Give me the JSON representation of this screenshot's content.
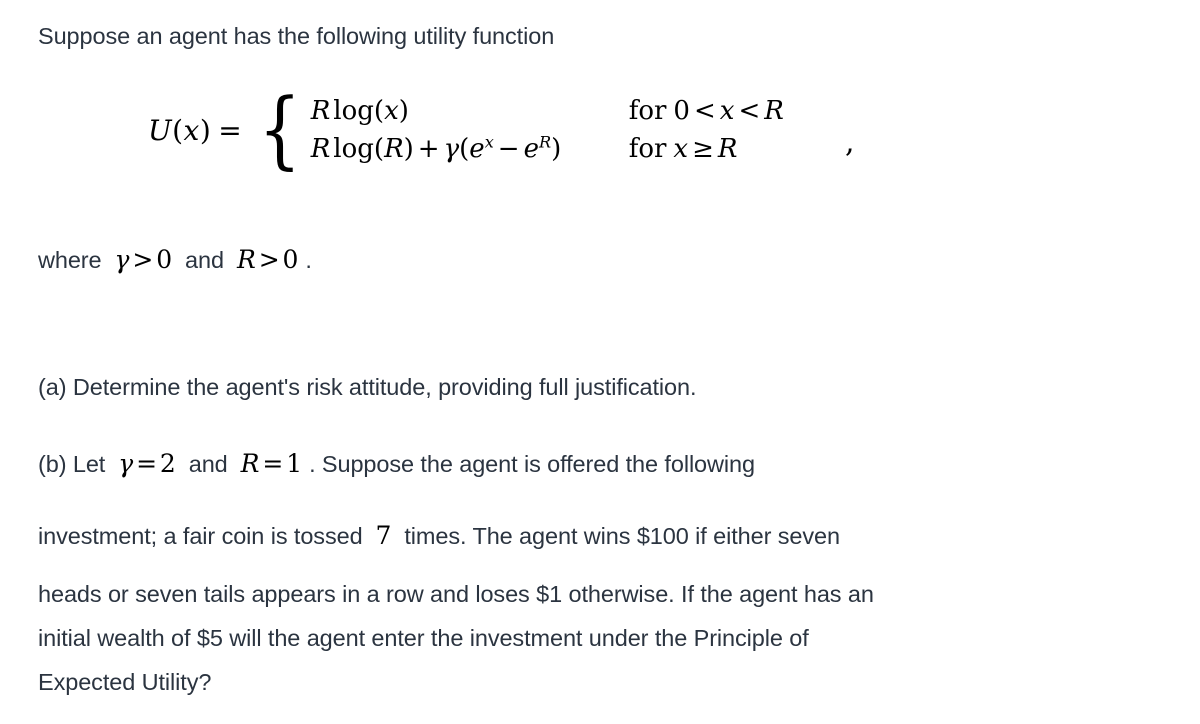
{
  "document": {
    "background_color": "#ffffff",
    "text_color": "#2b3440",
    "math_color": "#000000"
  },
  "intro": {
    "text": "Suppose an agent has the following utility function"
  },
  "equation": {
    "lhs": {
      "function_name": "U",
      "open_paren": "(",
      "argument": "x",
      "close_paren": ")",
      "equals": "="
    },
    "brace": "{",
    "cases": [
      {
        "expression_R": "R",
        "expression_log": "log",
        "expression_open": "(",
        "expression_arg": "x",
        "expression_close": ")",
        "condition_for": "for",
        "condition_lower": "0",
        "condition_lt1": "<",
        "condition_var": "x",
        "condition_lt2": "<",
        "condition_upper": "R"
      },
      {
        "expression_R": "R",
        "expression_log": "log",
        "expression_open": "(",
        "expression_arg": "R",
        "expression_close": ")",
        "plus": "+",
        "gamma": "γ",
        "group_open": "(",
        "e1": "e",
        "e1_exp": "x",
        "minus": "−",
        "e2": "e",
        "e2_exp": "R",
        "group_close": ")",
        "condition_for": "for",
        "condition_var": "x",
        "condition_rel": "≥",
        "condition_upper": "R"
      }
    ],
    "trailing_comma": ","
  },
  "where_line": {
    "where": "where",
    "gamma": "γ",
    "gamma_rel": ">",
    "gamma_value": "0",
    "and": "and",
    "R": "R",
    "R_rel": ">",
    "R_value": "0",
    "period": "."
  },
  "part_a": {
    "text": "(a) Determine the agent's risk attitude, providing full justification."
  },
  "part_b": {
    "line1_prefix": "(b) Let",
    "gamma": "γ",
    "gamma_eq": "=",
    "gamma_value": "2",
    "and": "and",
    "R": "R",
    "R_eq": "=",
    "R_value": "1",
    "line1_suffix": ". Suppose the agent is offered the following",
    "line2_prefix": "investment; a fair coin is tossed",
    "tosses": "7",
    "line2_suffix": "times. The agent wins $100 if either seven",
    "line3": "heads or seven tails appears in a row and loses $1 otherwise. If the agent has an",
    "line4": "initial wealth of $5 will the agent enter the investment under the Principle of",
    "line5": "Expected Utility?"
  }
}
